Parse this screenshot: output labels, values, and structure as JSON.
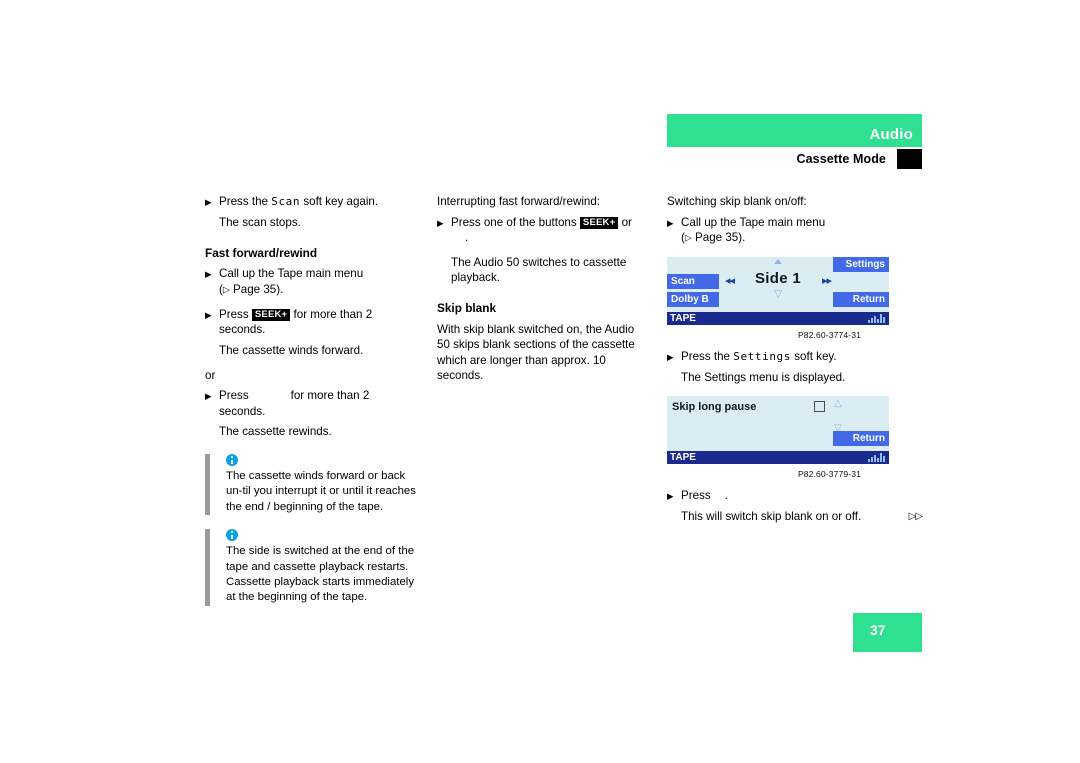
{
  "header": {
    "band_title": "Audio",
    "subtitle": "Cassette Mode",
    "band_color": "#2ee08f"
  },
  "columns": {
    "left": {
      "step_scan_again": {
        "bullet": "▶",
        "pre": "Press the",
        "softkey": "Scan",
        "post": "soft key again."
      },
      "scan_result": "The scan stops.",
      "heading_ffwd": "Fast forward/rewind",
      "step_call_menu": {
        "bullet": "▶",
        "line1": "Call up the Tape main menu",
        "line2_pre": "(",
        "line2_tri": "▷",
        "line2_post": " Page 35)."
      },
      "step_seek_plus": {
        "bullet": "▶",
        "pre": "Press",
        "key": "SEEK+",
        "post": "for more than 2 seconds."
      },
      "seek_plus_result": "The cassette winds forward.",
      "or_text": "or",
      "step_seek_minus": {
        "bullet": "▶",
        "pre": "Press",
        "key": "",
        "post": "for more than 2 seconds."
      },
      "seek_minus_result": "The cassette rewinds.",
      "note1": "The cassette winds forward or back un-til you interrupt it or until it reaches the end / beginning of the tape.",
      "note2": "The side is switched at the end of the tape and cassette playback restarts. Cassette playback starts immediately at the beginning of the tape."
    },
    "middle": {
      "intro": "Interrupting fast forward/rewind:",
      "step_press_buttons": {
        "bullet": "▶",
        "pre": "Press one of the buttons",
        "key": "SEEK+",
        "post": "or",
        "line2": "."
      },
      "result_line1": "The Audio 50 switches to cassette",
      "result_line2": "playback.",
      "heading_skip_blank": "Skip blank",
      "body": "With skip blank switched on, the Audio 50 skips blank sections of the cassette which are longer than approx. 10 seconds."
    },
    "right": {
      "intro": "Switching skip blank on/off:",
      "step_call_menu": {
        "bullet": "▶",
        "line1": "Call up the Tape main menu",
        "line2_pre": "(",
        "line2_tri": "▷",
        "line2_post": " Page 35)."
      },
      "step_settings": {
        "bullet": "▶",
        "pre": "Press the",
        "softkey": "Settings",
        "post": "soft key."
      },
      "settings_result": "The Settings menu is displayed.",
      "step_press_final": {
        "bullet": "▶",
        "pre": "Press",
        "post": "."
      },
      "final_result": "This will switch skip blank on or off.",
      "continuation": "▷▷"
    }
  },
  "screens": {
    "tape_main": {
      "softkey_top_left": "Scan",
      "softkey_bottom_left": "Dolby B",
      "softkey_top_right": "Settings",
      "softkey_bottom_right": "Return",
      "title": "Side 1",
      "prev_icon": "◂◂",
      "next_icon": "▸▸",
      "status_source": "TAPE",
      "caption": "P82.60-3774-31"
    },
    "settings": {
      "label": "Skip long pause",
      "checkbox_checked": false,
      "softkey_bottom_right": "Return",
      "status_source": "TAPE",
      "caption": "P82.60-3779-31"
    }
  },
  "footer": {
    "page_number": "37"
  }
}
